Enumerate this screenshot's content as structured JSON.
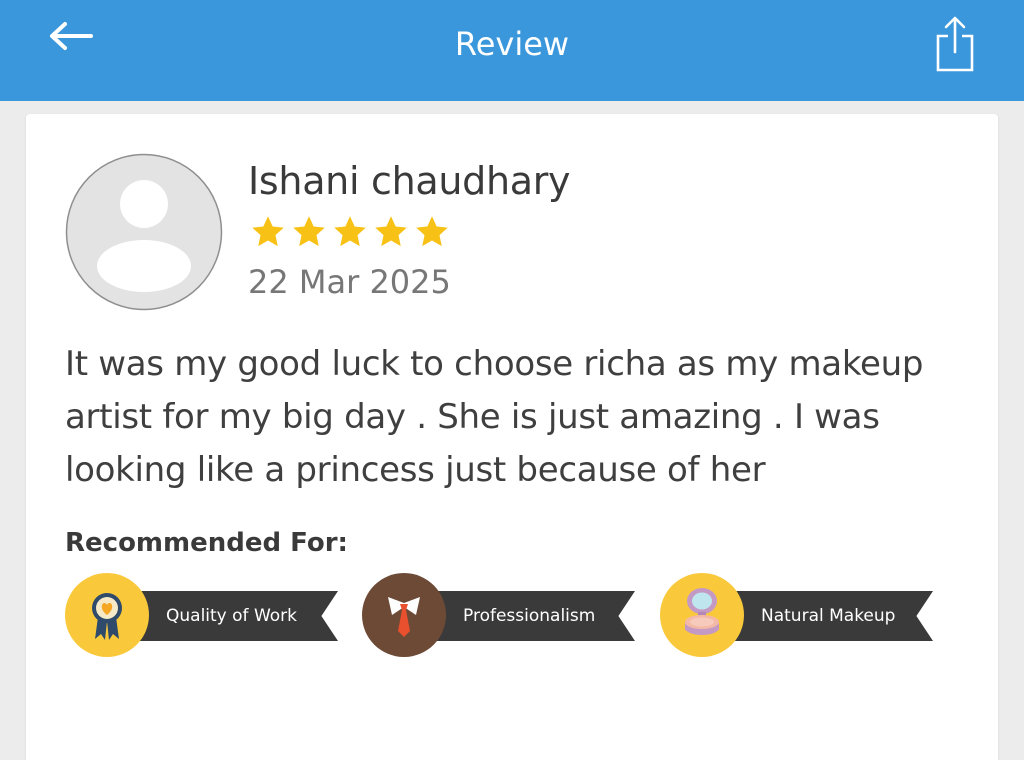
{
  "header": {
    "title": "Review",
    "back_icon": "arrow-left-icon",
    "share_icon": "share-icon"
  },
  "review": {
    "reviewer_name": "Ishani chaudhary",
    "rating": 5,
    "max_rating": 5,
    "date": "22 Mar 2025",
    "text": "It was my good luck to choose richa as my makeup artist for my big day . She is just amazing . I was looking like a princess just because of her"
  },
  "recommended": {
    "title": "Recommended For:",
    "items": [
      {
        "label": "Quality of Work",
        "icon": "award-ribbon-icon"
      },
      {
        "label": "Professionalism",
        "icon": "shirt-tie-icon"
      },
      {
        "label": "Natural Makeup",
        "icon": "compact-mirror-icon"
      }
    ]
  },
  "colors": {
    "header_bg": "#3a97dc",
    "star": "#f8c116",
    "badge_dark": "#3a3a3a",
    "badge_yellow": "#f9c93b",
    "badge_brown": "#6d4a36"
  }
}
